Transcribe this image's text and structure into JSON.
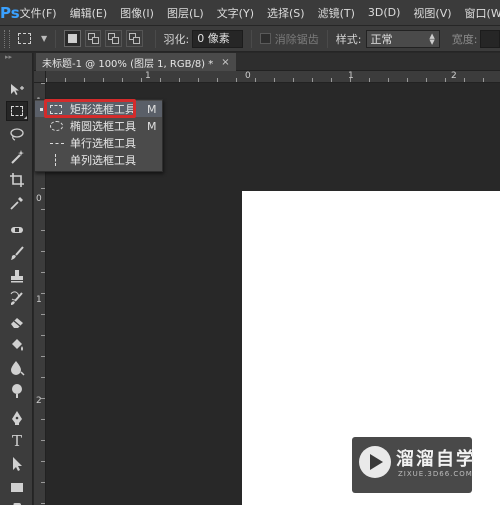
{
  "app": {
    "logo": "Ps"
  },
  "menu": [
    "文件(F)",
    "编辑(E)",
    "图像(I)",
    "图层(L)",
    "文字(Y)",
    "选择(S)",
    "滤镜(T)",
    "3D(D)",
    "视图(V)",
    "窗口(W)"
  ],
  "options": {
    "feather_label": "羽化:",
    "feather_value": "0 像素",
    "antialias_label": "消除锯齿",
    "style_label": "样式:",
    "style_value": "正常",
    "width_label": "宽度:"
  },
  "document": {
    "tab_title": "未标题-1 @ 100% (图层 1, RGB/8) *",
    "close_glyph": "×",
    "ruler_top": [
      "1",
      "0",
      "1",
      "2"
    ],
    "ruler_left": [
      "1",
      "0",
      "1",
      "2"
    ]
  },
  "flyout": {
    "items": [
      {
        "label": "矩形选框工具",
        "key": "M",
        "icon": "rect-marquee-icon",
        "selected": true
      },
      {
        "label": "椭圆选框工具",
        "key": "M",
        "icon": "ellipse-marquee-icon"
      },
      {
        "label": "单行选框工具",
        "key": "",
        "icon": "single-row-marquee-icon"
      },
      {
        "label": "单列选框工具",
        "key": "",
        "icon": "single-column-marquee-icon"
      }
    ]
  },
  "tools": [
    "move-tool-icon",
    "marquee-tool-icon",
    "lasso-tool-icon",
    "quick-select-tool-icon",
    "crop-tool-icon",
    "eyedropper-tool-icon",
    "healing-brush-icon",
    "brush-tool-icon",
    "clone-stamp-icon",
    "history-brush-icon",
    "eraser-tool-icon",
    "paint-bucket-icon",
    "blur-tool-icon",
    "dodge-tool-icon",
    "pen-tool-icon",
    "type-tool-icon",
    "path-select-icon",
    "rectangle-shape-icon",
    "hand-tool-icon"
  ],
  "watermark": {
    "title": "溜溜自学",
    "subtitle": "ZIXUE.3D66.COM"
  },
  "colors": {
    "highlight": "#d32b2b",
    "accent": "#3aa1ff"
  }
}
